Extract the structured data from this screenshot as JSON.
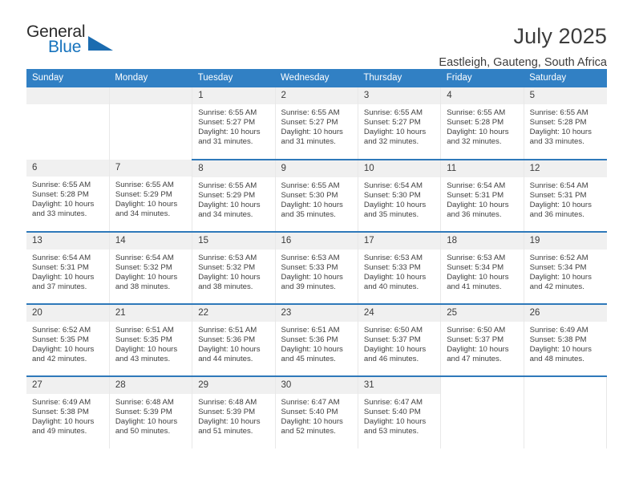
{
  "brand": {
    "name_top": "General",
    "name_bottom": "Blue",
    "triangle_color": "#1b6cb0",
    "blue_text_color": "#1673bd"
  },
  "header": {
    "title": "July 2025",
    "subtitle": "Eastleigh, Gauteng, South Africa"
  },
  "theme": {
    "header_row_bg": "#3180c4",
    "row_divider": "#2f79ba",
    "daynum_band_bg": "#f0f0f0",
    "cell_divider": "#e8e8e8"
  },
  "weekday_headers": [
    "Sunday",
    "Monday",
    "Tuesday",
    "Wednesday",
    "Thursday",
    "Friday",
    "Saturday"
  ],
  "labels": {
    "sunrise_prefix": "Sunrise:",
    "sunset_prefix": "Sunset:",
    "daylight_prefix": "Daylight:"
  },
  "weeks": [
    [
      {
        "day": "",
        "blank": true,
        "band": true
      },
      {
        "day": "",
        "blank": true,
        "band": true
      },
      {
        "day": "1",
        "sunrise": "Sunrise: 6:55 AM",
        "sunset": "Sunset: 5:27 PM",
        "daylight_l1": "Daylight: 10 hours",
        "daylight_l2": "and 31 minutes."
      },
      {
        "day": "2",
        "sunrise": "Sunrise: 6:55 AM",
        "sunset": "Sunset: 5:27 PM",
        "daylight_l1": "Daylight: 10 hours",
        "daylight_l2": "and 31 minutes."
      },
      {
        "day": "3",
        "sunrise": "Sunrise: 6:55 AM",
        "sunset": "Sunset: 5:27 PM",
        "daylight_l1": "Daylight: 10 hours",
        "daylight_l2": "and 32 minutes."
      },
      {
        "day": "4",
        "sunrise": "Sunrise: 6:55 AM",
        "sunset": "Sunset: 5:28 PM",
        "daylight_l1": "Daylight: 10 hours",
        "daylight_l2": "and 32 minutes."
      },
      {
        "day": "5",
        "sunrise": "Sunrise: 6:55 AM",
        "sunset": "Sunset: 5:28 PM",
        "daylight_l1": "Daylight: 10 hours",
        "daylight_l2": "and 33 minutes."
      }
    ],
    [
      {
        "day": "6",
        "sunrise": "Sunrise: 6:55 AM",
        "sunset": "Sunset: 5:28 PM",
        "daylight_l1": "Daylight: 10 hours",
        "daylight_l2": "and 33 minutes."
      },
      {
        "day": "7",
        "sunrise": "Sunrise: 6:55 AM",
        "sunset": "Sunset: 5:29 PM",
        "daylight_l1": "Daylight: 10 hours",
        "daylight_l2": "and 34 minutes."
      },
      {
        "day": "8",
        "sunrise": "Sunrise: 6:55 AM",
        "sunset": "Sunset: 5:29 PM",
        "daylight_l1": "Daylight: 10 hours",
        "daylight_l2": "and 34 minutes."
      },
      {
        "day": "9",
        "sunrise": "Sunrise: 6:55 AM",
        "sunset": "Sunset: 5:30 PM",
        "daylight_l1": "Daylight: 10 hours",
        "daylight_l2": "and 35 minutes."
      },
      {
        "day": "10",
        "sunrise": "Sunrise: 6:54 AM",
        "sunset": "Sunset: 5:30 PM",
        "daylight_l1": "Daylight: 10 hours",
        "daylight_l2": "and 35 minutes."
      },
      {
        "day": "11",
        "sunrise": "Sunrise: 6:54 AM",
        "sunset": "Sunset: 5:31 PM",
        "daylight_l1": "Daylight: 10 hours",
        "daylight_l2": "and 36 minutes."
      },
      {
        "day": "12",
        "sunrise": "Sunrise: 6:54 AM",
        "sunset": "Sunset: 5:31 PM",
        "daylight_l1": "Daylight: 10 hours",
        "daylight_l2": "and 36 minutes."
      }
    ],
    [
      {
        "day": "13",
        "sunrise": "Sunrise: 6:54 AM",
        "sunset": "Sunset: 5:31 PM",
        "daylight_l1": "Daylight: 10 hours",
        "daylight_l2": "and 37 minutes."
      },
      {
        "day": "14",
        "sunrise": "Sunrise: 6:54 AM",
        "sunset": "Sunset: 5:32 PM",
        "daylight_l1": "Daylight: 10 hours",
        "daylight_l2": "and 38 minutes."
      },
      {
        "day": "15",
        "sunrise": "Sunrise: 6:53 AM",
        "sunset": "Sunset: 5:32 PM",
        "daylight_l1": "Daylight: 10 hours",
        "daylight_l2": "and 38 minutes."
      },
      {
        "day": "16",
        "sunrise": "Sunrise: 6:53 AM",
        "sunset": "Sunset: 5:33 PM",
        "daylight_l1": "Daylight: 10 hours",
        "daylight_l2": "and 39 minutes."
      },
      {
        "day": "17",
        "sunrise": "Sunrise: 6:53 AM",
        "sunset": "Sunset: 5:33 PM",
        "daylight_l1": "Daylight: 10 hours",
        "daylight_l2": "and 40 minutes."
      },
      {
        "day": "18",
        "sunrise": "Sunrise: 6:53 AM",
        "sunset": "Sunset: 5:34 PM",
        "daylight_l1": "Daylight: 10 hours",
        "daylight_l2": "and 41 minutes."
      },
      {
        "day": "19",
        "sunrise": "Sunrise: 6:52 AM",
        "sunset": "Sunset: 5:34 PM",
        "daylight_l1": "Daylight: 10 hours",
        "daylight_l2": "and 42 minutes."
      }
    ],
    [
      {
        "day": "20",
        "sunrise": "Sunrise: 6:52 AM",
        "sunset": "Sunset: 5:35 PM",
        "daylight_l1": "Daylight: 10 hours",
        "daylight_l2": "and 42 minutes."
      },
      {
        "day": "21",
        "sunrise": "Sunrise: 6:51 AM",
        "sunset": "Sunset: 5:35 PM",
        "daylight_l1": "Daylight: 10 hours",
        "daylight_l2": "and 43 minutes."
      },
      {
        "day": "22",
        "sunrise": "Sunrise: 6:51 AM",
        "sunset": "Sunset: 5:36 PM",
        "daylight_l1": "Daylight: 10 hours",
        "daylight_l2": "and 44 minutes."
      },
      {
        "day": "23",
        "sunrise": "Sunrise: 6:51 AM",
        "sunset": "Sunset: 5:36 PM",
        "daylight_l1": "Daylight: 10 hours",
        "daylight_l2": "and 45 minutes."
      },
      {
        "day": "24",
        "sunrise": "Sunrise: 6:50 AM",
        "sunset": "Sunset: 5:37 PM",
        "daylight_l1": "Daylight: 10 hours",
        "daylight_l2": "and 46 minutes."
      },
      {
        "day": "25",
        "sunrise": "Sunrise: 6:50 AM",
        "sunset": "Sunset: 5:37 PM",
        "daylight_l1": "Daylight: 10 hours",
        "daylight_l2": "and 47 minutes."
      },
      {
        "day": "26",
        "sunrise": "Sunrise: 6:49 AM",
        "sunset": "Sunset: 5:38 PM",
        "daylight_l1": "Daylight: 10 hours",
        "daylight_l2": "and 48 minutes."
      }
    ],
    [
      {
        "day": "27",
        "sunrise": "Sunrise: 6:49 AM",
        "sunset": "Sunset: 5:38 PM",
        "daylight_l1": "Daylight: 10 hours",
        "daylight_l2": "and 49 minutes."
      },
      {
        "day": "28",
        "sunrise": "Sunrise: 6:48 AM",
        "sunset": "Sunset: 5:39 PM",
        "daylight_l1": "Daylight: 10 hours",
        "daylight_l2": "and 50 minutes."
      },
      {
        "day": "29",
        "sunrise": "Sunrise: 6:48 AM",
        "sunset": "Sunset: 5:39 PM",
        "daylight_l1": "Daylight: 10 hours",
        "daylight_l2": "and 51 minutes."
      },
      {
        "day": "30",
        "sunrise": "Sunrise: 6:47 AM",
        "sunset": "Sunset: 5:40 PM",
        "daylight_l1": "Daylight: 10 hours",
        "daylight_l2": "and 52 minutes."
      },
      {
        "day": "31",
        "sunrise": "Sunrise: 6:47 AM",
        "sunset": "Sunset: 5:40 PM",
        "daylight_l1": "Daylight: 10 hours",
        "daylight_l2": "and 53 minutes."
      },
      {
        "day": "",
        "blank": true,
        "band": false
      },
      {
        "day": "",
        "blank": true,
        "band": false
      }
    ]
  ]
}
